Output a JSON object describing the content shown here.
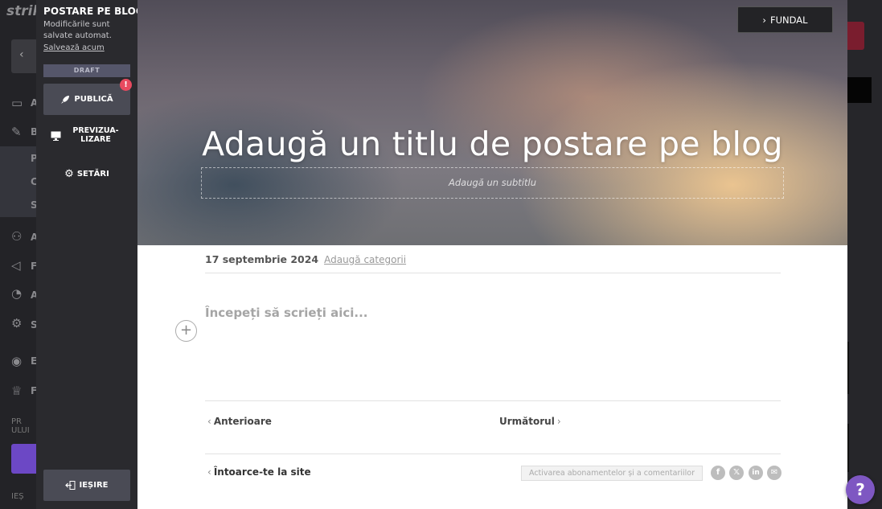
{
  "background_app": {
    "logo": "strik",
    "sidebar_letters": [
      "A",
      "B",
      "P",
      "C",
      "S",
      "A",
      "F",
      "A",
      "S",
      "E",
      "F"
    ],
    "small_text": [
      "PR",
      "ULUI",
      "IEȘ"
    ]
  },
  "panel": {
    "title": "POSTARE PE BLOG",
    "autosave_text": "Modificările sunt salvate automat.",
    "save_now_label": "Salvează acum",
    "status_label": "DRAFT",
    "publish_label": "PUBLICĂ",
    "publish_badge": "!",
    "preview_label_line1": "PREVIZUA-",
    "preview_label_line2": "LIZARE",
    "settings_label": "SETĂRI",
    "exit_label": "IEȘIRE"
  },
  "hero": {
    "background_button_label": "FUNDAL",
    "title_placeholder": "Adaugă un titlu de postare pe blog",
    "subtitle_placeholder": "Adaugă un subtitlu"
  },
  "post": {
    "date": "17 septembrie 2024",
    "add_categories_label": "Adaugă categorii",
    "body_placeholder": "Începeți să scrieți aici...",
    "add_block_symbol": "+",
    "previous_label": "Anterioare",
    "next_label": "Următorul",
    "back_to_site_label": "Întoarce-te la site",
    "subscriptions_label": "Activarea abonamentelor și a comentariilor",
    "social_icons": [
      "facebook-icon",
      "x-icon",
      "linkedin-icon",
      "email-icon"
    ]
  },
  "help_label": "?",
  "colors": {
    "panel_bg": "#2a2a2e",
    "button_bg": "#4a4b55",
    "badge_red": "#e84a5f",
    "help_purple": "#7e57c2",
    "draft_bg": "#55566a"
  }
}
